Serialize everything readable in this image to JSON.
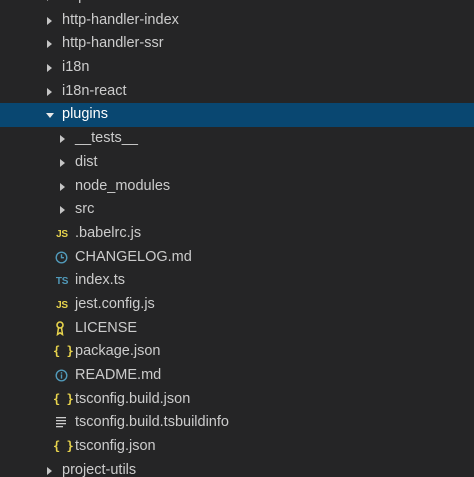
{
  "explorer": {
    "cut_off_top_item": "http-handler-node",
    "items": [
      {
        "label": "http-handler-index",
        "type": "folder",
        "level": 0,
        "expanded": false
      },
      {
        "label": "http-handler-ssr",
        "type": "folder",
        "level": 0,
        "expanded": false
      },
      {
        "label": "i18n",
        "type": "folder",
        "level": 0,
        "expanded": false
      },
      {
        "label": "i18n-react",
        "type": "folder",
        "level": 0,
        "expanded": false
      },
      {
        "label": "plugins",
        "type": "folder",
        "level": 0,
        "expanded": true,
        "selected": true
      },
      {
        "label": "__tests__",
        "type": "folder",
        "level": 1,
        "expanded": false
      },
      {
        "label": "dist",
        "type": "folder",
        "level": 1,
        "expanded": false
      },
      {
        "label": "node_modules",
        "type": "folder",
        "level": 1,
        "expanded": false
      },
      {
        "label": "src",
        "type": "folder",
        "level": 1,
        "expanded": false
      },
      {
        "label": ".babelrc.js",
        "type": "file",
        "level": 1,
        "icon": "js-icon",
        "icon_text": "JS"
      },
      {
        "label": "CHANGELOG.md",
        "type": "file",
        "level": 1,
        "icon": "clock-icon"
      },
      {
        "label": "index.ts",
        "type": "file",
        "level": 1,
        "icon": "ts-icon",
        "icon_text": "TS"
      },
      {
        "label": "jest.config.js",
        "type": "file",
        "level": 1,
        "icon": "js-icon",
        "icon_text": "JS"
      },
      {
        "label": "LICENSE",
        "type": "file",
        "level": 1,
        "icon": "license-icon"
      },
      {
        "label": "package.json",
        "type": "file",
        "level": 1,
        "icon": "json-icon",
        "icon_text": "{ }"
      },
      {
        "label": "README.md",
        "type": "file",
        "level": 1,
        "icon": "info-icon"
      },
      {
        "label": "tsconfig.build.json",
        "type": "file",
        "level": 1,
        "icon": "json-icon",
        "icon_text": "{ }"
      },
      {
        "label": "tsconfig.build.tsbuildinfo",
        "type": "file",
        "level": 1,
        "icon": "lines-icon"
      },
      {
        "label": "tsconfig.json",
        "type": "file",
        "level": 1,
        "icon": "json-icon",
        "icon_text": "{ }"
      },
      {
        "label": "project-utils",
        "type": "folder",
        "level": 0,
        "expanded": false
      }
    ]
  },
  "colors": {
    "background": "#252526",
    "selected_background": "#094771",
    "text": "#cccccc",
    "js_icon": "#e8d44d",
    "ts_icon": "#519aba",
    "json_icon": "#e8d44d",
    "md_icon": "#519aba",
    "license_icon": "#e8d44d",
    "tsbuildinfo_icon": "#cccccc"
  }
}
